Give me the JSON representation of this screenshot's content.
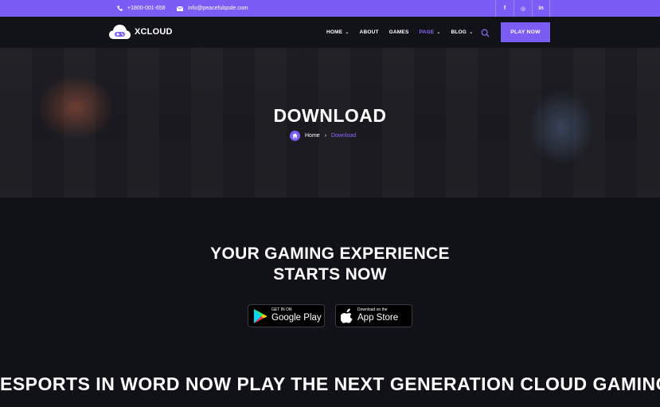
{
  "topbar": {
    "phone": "+1800-001-658",
    "email": "info@peacefulqode.com",
    "social": [
      {
        "icon": "facebook-icon",
        "glyph": "f"
      },
      {
        "icon": "instagram-icon",
        "glyph": "◎"
      },
      {
        "icon": "linkedin-icon",
        "glyph": "in"
      }
    ]
  },
  "nav": {
    "logo_text": "XCLOUD",
    "items": [
      {
        "label": "HOME",
        "has_dropdown": true
      },
      {
        "label": "ABOUT",
        "has_dropdown": false
      },
      {
        "label": "GAMES",
        "has_dropdown": false
      },
      {
        "label": "PAGE",
        "has_dropdown": true,
        "active": true
      },
      {
        "label": "BLOG",
        "has_dropdown": true
      }
    ],
    "cta_label": "PLAY NOW"
  },
  "hero": {
    "title": "DOWNLOAD",
    "breadcrumb": {
      "home": "Home",
      "current": "Download"
    }
  },
  "main": {
    "headline_line1": "YOUR GAMING EXPERIENCE",
    "headline_line2": "STARTS NOW",
    "google_play": {
      "small": "GET IN ON",
      "big": "Google Play"
    },
    "app_store": {
      "small": "Download on the",
      "big": "App Store"
    },
    "marquee": "ESPORTS IN WORD NOW PLAY THE NEXT GENERATION CLOUD GAMING"
  },
  "colors": {
    "accent": "#7b5cf5",
    "background": "#111118",
    "active_link": "#8f6bff"
  }
}
